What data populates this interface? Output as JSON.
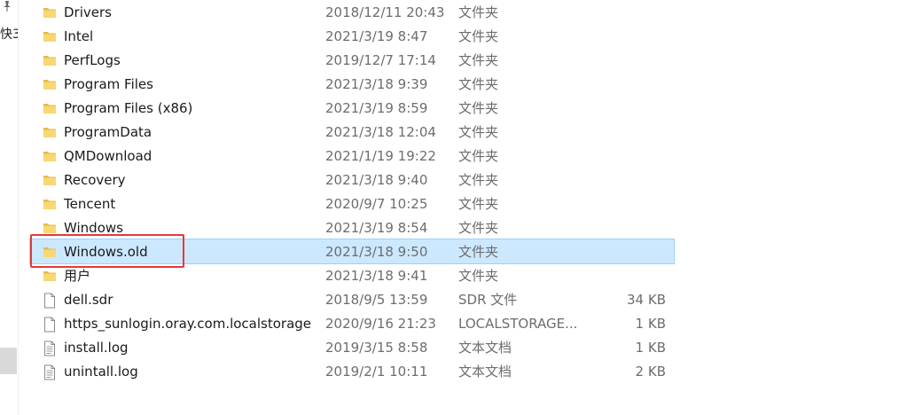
{
  "left_pane": {
    "pin_icon": "pin-icon",
    "label": "快3"
  },
  "files": [
    {
      "name": "Drivers",
      "date": "2018/12/11 20:43",
      "type": "文件夹",
      "size": "",
      "icon": "folder-icon"
    },
    {
      "name": "Intel",
      "date": "2021/3/19 8:47",
      "type": "文件夹",
      "size": "",
      "icon": "folder-icon"
    },
    {
      "name": "PerfLogs",
      "date": "2019/12/7 17:14",
      "type": "文件夹",
      "size": "",
      "icon": "folder-icon"
    },
    {
      "name": "Program Files",
      "date": "2021/3/18 9:39",
      "type": "文件夹",
      "size": "",
      "icon": "folder-icon"
    },
    {
      "name": "Program Files (x86)",
      "date": "2021/3/19 8:59",
      "type": "文件夹",
      "size": "",
      "icon": "folder-icon"
    },
    {
      "name": "ProgramData",
      "date": "2021/3/18 12:04",
      "type": "文件夹",
      "size": "",
      "icon": "folder-icon"
    },
    {
      "name": "QMDownload",
      "date": "2021/1/19 19:22",
      "type": "文件夹",
      "size": "",
      "icon": "folder-icon"
    },
    {
      "name": "Recovery",
      "date": "2021/3/18 9:40",
      "type": "文件夹",
      "size": "",
      "icon": "folder-icon"
    },
    {
      "name": "Tencent",
      "date": "2020/9/7 10:25",
      "type": "文件夹",
      "size": "",
      "icon": "folder-icon"
    },
    {
      "name": "Windows",
      "date": "2021/3/19 8:54",
      "type": "文件夹",
      "size": "",
      "icon": "folder-icon"
    },
    {
      "name": "Windows.old",
      "date": "2021/3/18 9:50",
      "type": "文件夹",
      "size": "",
      "icon": "folder-icon",
      "selected": true
    },
    {
      "name": "用户",
      "date": "2021/3/18 9:41",
      "type": "文件夹",
      "size": "",
      "icon": "folder-icon"
    },
    {
      "name": "dell.sdr",
      "date": "2018/9/5 13:59",
      "type": "SDR 文件",
      "size": "34 KB",
      "icon": "file-icon"
    },
    {
      "name": "https_sunlogin.oray.com.localstorage",
      "date": "2020/9/16 21:23",
      "type": "LOCALSTORAGE...",
      "size": "1 KB",
      "icon": "file-icon"
    },
    {
      "name": "install.log",
      "date": "2019/3/15 8:58",
      "type": "文本文档",
      "size": "1 KB",
      "icon": "text-file-icon"
    },
    {
      "name": "unintall.log",
      "date": "2019/2/1 10:11",
      "type": "文本文档",
      "size": "2 KB",
      "icon": "text-file-icon"
    }
  ],
  "colors": {
    "selection_bg": "#cce8ff",
    "selection_border": "#99d1ff",
    "highlight_box": "#e53935",
    "folder_yellow": "#f8d775"
  }
}
